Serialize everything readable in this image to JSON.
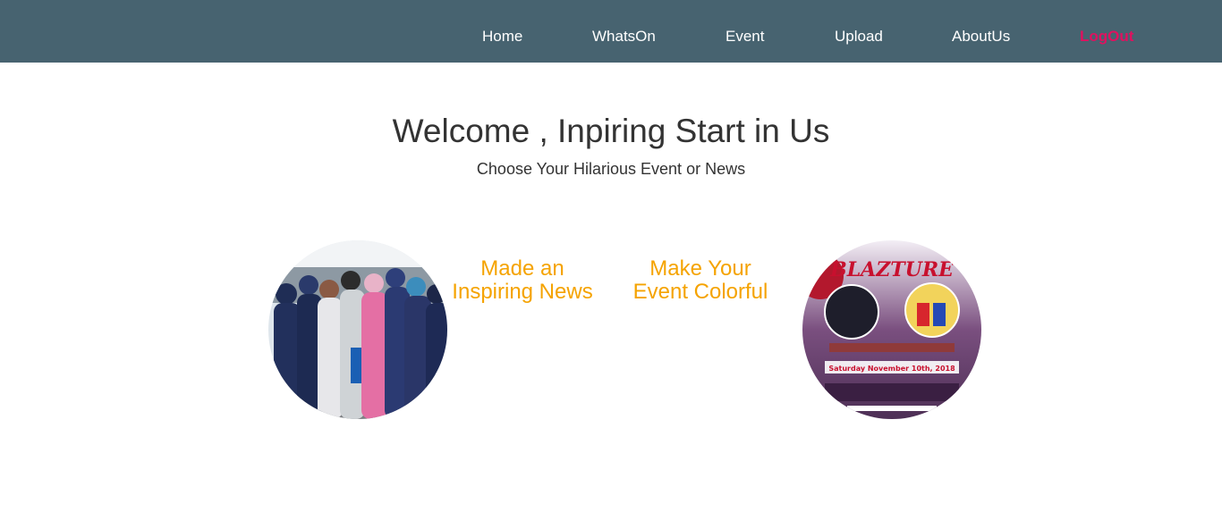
{
  "nav": {
    "items": [
      {
        "label": "Home"
      },
      {
        "label": "WhatsOn"
      },
      {
        "label": "Event"
      },
      {
        "label": "Upload"
      },
      {
        "label": "AboutUs"
      },
      {
        "label": "LogOut"
      }
    ]
  },
  "hero": {
    "title": "Welcome , Inpiring Start in Us",
    "subtitle": "Choose Your Hilarious Event or News"
  },
  "features": {
    "news": {
      "line1": "Made an",
      "line2": "Inspiring News"
    },
    "event": {
      "line1": "Make Your",
      "line2": "Event Colorful"
    }
  },
  "poster": {
    "title": "BLAZTURE",
    "date": "Saturday November 10th, 2018"
  },
  "colors": {
    "navbar": "#476370",
    "accent": "#f5a300",
    "logout": "#e0115f"
  }
}
